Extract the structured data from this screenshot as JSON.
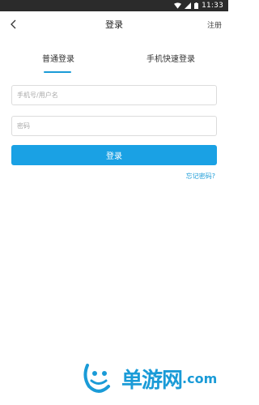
{
  "status_bar": {
    "time": "11:33",
    "icons": [
      "wifi-icon",
      "signal-icon",
      "battery-icon"
    ]
  },
  "nav": {
    "back_icon": "chevron-left-icon",
    "title": "登录",
    "register_label": "注册"
  },
  "tabs": [
    {
      "label": "普通登录",
      "active": true
    },
    {
      "label": "手机快速登录",
      "active": false
    }
  ],
  "form": {
    "username_placeholder": "手机号/用户名",
    "username_value": "",
    "password_placeholder": "密码",
    "password_value": "",
    "login_label": "登录",
    "forgot_label": "忘记密码?"
  },
  "watermark": {
    "text": "单游网",
    "suffix": ".com"
  },
  "colors": {
    "accent": "#1aa1e4",
    "link": "#1a9bd7",
    "status_bar": "#2b2b2b"
  }
}
